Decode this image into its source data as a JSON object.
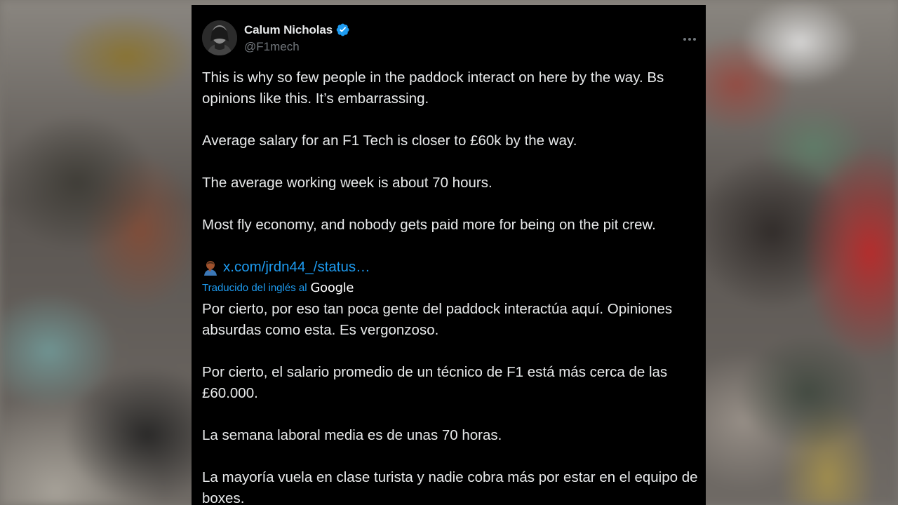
{
  "tweet": {
    "author": {
      "display_name": "Calum Nicholas",
      "handle": "@F1mech",
      "verified": true
    },
    "original_paragraphs": [
      "This is why so few people in the paddock interact on here by the way. Bs opinions like this. It’s embarrassing.",
      "Average salary for an F1 Tech is closer to £60k by the way.",
      "The average working week is about 70 hours.",
      "Most fly economy, and nobody gets paid more for being on the pit crew."
    ],
    "quoted_link": "x.com/jrdn44_/status…",
    "translation": {
      "label": "Traducido del inglés al",
      "provider": "Google",
      "paragraphs": [
        "Por cierto, por eso tan poca gente del paddock interactúa aquí. Opiniones absurdas como esta. Es vergonzoso.",
        "Por cierto, el salario promedio de un técnico de F1 está más cerca de las £60.000.",
        "La semana laboral media es de unas 70 horas.",
        "La mayoría vuela en clase turista y nadie cobra más por estar en el equipo de boxes."
      ]
    }
  },
  "colors": {
    "card_background": "#000000",
    "text_primary": "#e7e9ea",
    "text_secondary": "#71767b",
    "accent_blue": "#1d9bf0"
  },
  "icons": {
    "verified": "verified-badge-icon",
    "more": "more-options-icon",
    "link_emoji": "person-facepalming-emoji-icon"
  }
}
